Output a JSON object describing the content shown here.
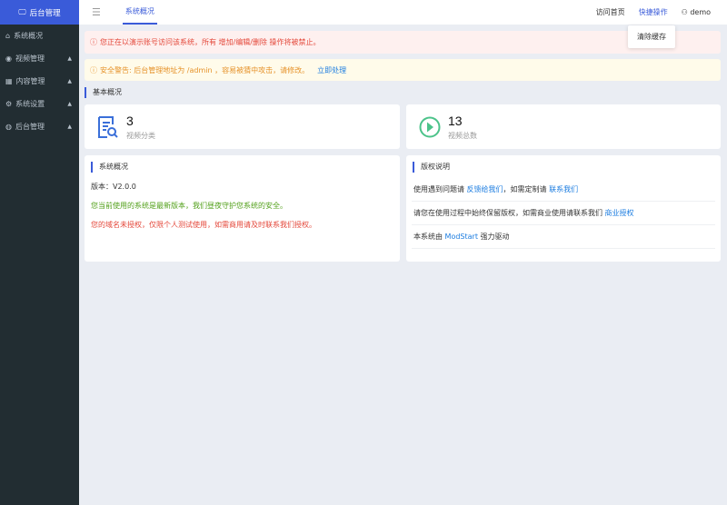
{
  "sidebar": {
    "logo": "后台管理",
    "items": [
      {
        "label": "系统概况",
        "icon": "home-icon"
      },
      {
        "label": "视频管理",
        "icon": "play-circle-icon"
      },
      {
        "label": "内容管理",
        "icon": "grid-icon"
      },
      {
        "label": "系统设置",
        "icon": "gear-icon"
      },
      {
        "label": "后台管理",
        "icon": "user-circle-icon"
      }
    ]
  },
  "header": {
    "tab": "系统概况",
    "visit_home": "访问首页",
    "quick_ops": "快捷操作",
    "user": "demo",
    "dropdown_item": "清除缓存"
  },
  "alerts": {
    "demo": "您正在以演示账号访问该系统，所有 增加/编辑/删除 操作将被禁止。",
    "security": "安全警告: 后台管理地址为 /admin ，容易被猜中攻击，请修改。",
    "security_link": "立即处理"
  },
  "section_title": "基本概况",
  "stats": [
    {
      "value": "3",
      "label": "视频分类"
    },
    {
      "value": "13",
      "label": "视频总数"
    }
  ],
  "system": {
    "title": "系统概况",
    "version": "版本：V2.0.0",
    "latest": "您当前使用的系统是最新版本，我们昼夜守护您系统的安全。",
    "unauth": "您的域名未授权，仅限个人测试使用，如需商用请及时联系我们授权。"
  },
  "copyright": {
    "title": "版权说明",
    "r1a": "使用遇到问题请",
    "r1l1": "反馈给我们",
    "r1b": "，如需定制请",
    "r1l2": "联系我们",
    "r2a": "请您在使用过程中始终保留版权，如需商业使用请联系我们",
    "r2l": "商业授权",
    "r3a": "本系统由",
    "r3l": "ModStart",
    "r3b": "强力驱动"
  },
  "colors": {
    "accent": "#3a5bd9",
    "sidebar": "#222d32",
    "danger": "#e4473a",
    "warning": "#e6922a",
    "success": "#52a01a",
    "link": "#1d7de0"
  }
}
